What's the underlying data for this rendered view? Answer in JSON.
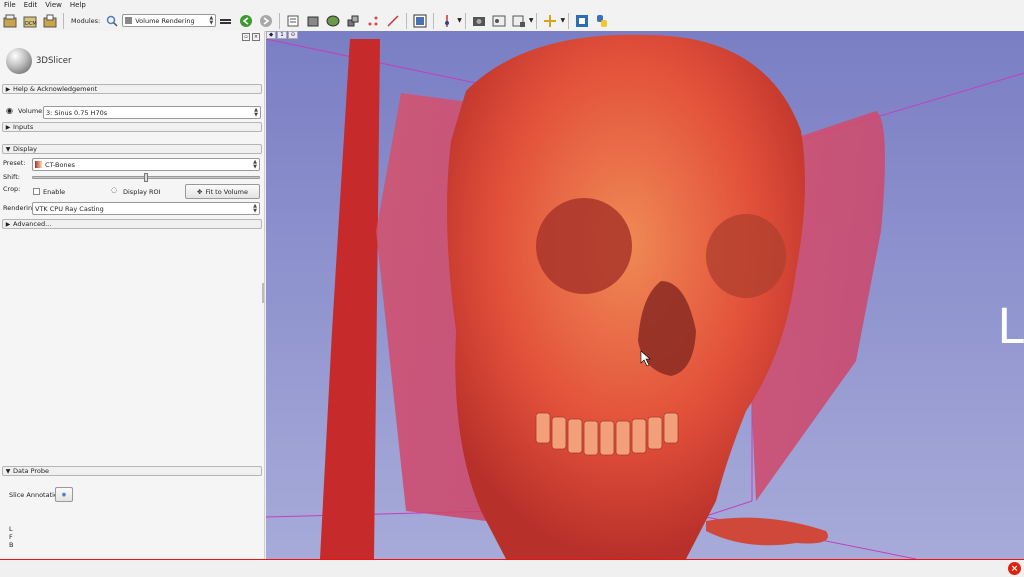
{
  "menu": [
    "File",
    "Edit",
    "View",
    "Help"
  ],
  "toolbar": {
    "modules_label": "Modules:",
    "module_value": "Volume Rendering"
  },
  "app": {
    "name": "3DSlicer"
  },
  "sections": {
    "help": "Help & Acknowledgement",
    "inputs": "Inputs",
    "display": "Display",
    "advanced": "Advanced...",
    "data_probe": "Data Probe"
  },
  "volume": {
    "label": "Volume:",
    "value": "3: Sinus  0.75  H70s"
  },
  "display": {
    "preset_label": "Preset:",
    "preset_value": "CT-Bones",
    "shift_label": "Shift:",
    "shift_fraction": 0.5,
    "crop_label": "Crop:",
    "enable_label": "Enable",
    "display_roi_label": "Display ROI",
    "fit_button": "Fit to Volume",
    "rendering_label": "Rendering:",
    "rendering_value": "VTK CPU Ray Casting"
  },
  "data_probe": {
    "slice_annotations_label": "Slice Annotations:",
    "coords": [
      "L",
      "F",
      "B"
    ]
  },
  "viewer": {
    "tab_label": "1",
    "orientation_letter": "L"
  },
  "colors": {
    "accent": "#e11b1b",
    "bg_top": "#7a7ec4",
    "bg_bottom": "#a7abd9"
  }
}
